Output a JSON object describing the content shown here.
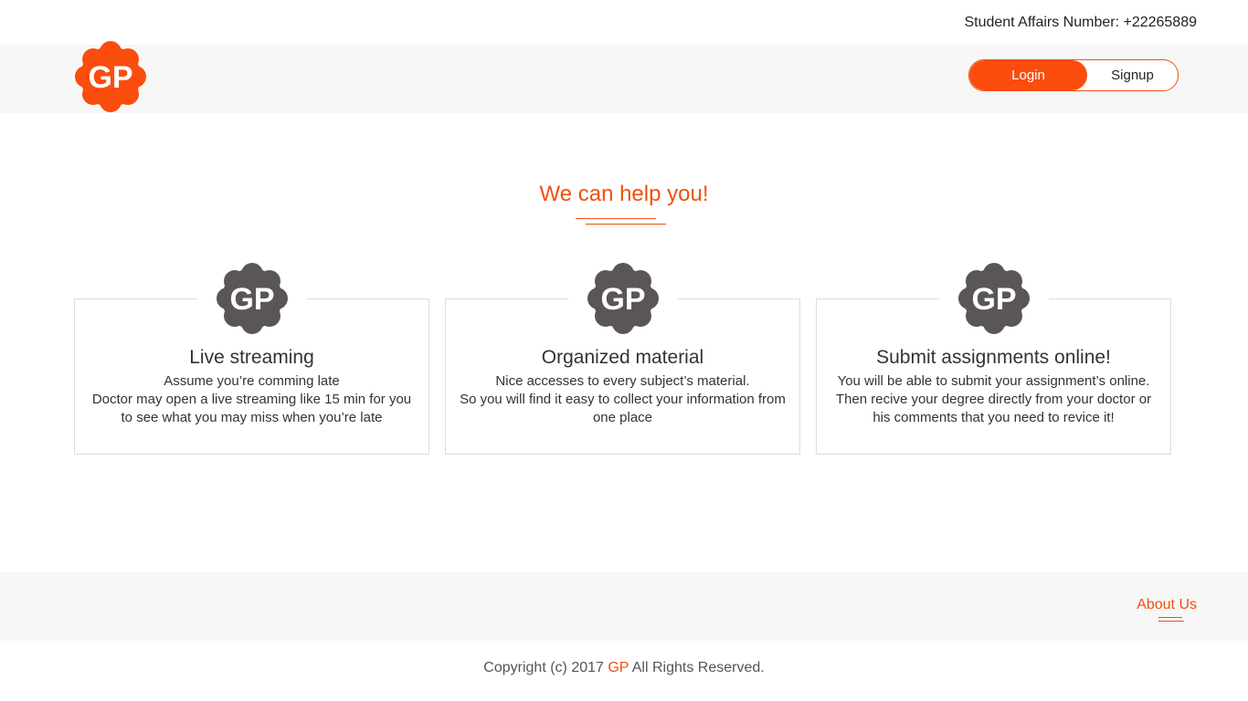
{
  "topbar": {
    "student_affairs": "Student Affairs Number: +22265889"
  },
  "header": {
    "logo_text": "GP",
    "login_label": "Login",
    "signup_label": "Signup"
  },
  "colors": {
    "accent": "#fa4d0e",
    "icon_gray": "#5a5655",
    "text": "#333333",
    "band": "#f7f7f7"
  },
  "section": {
    "title": "We can help you!"
  },
  "features": [
    {
      "icon": "GP",
      "title": "Live streaming",
      "line1": "Assume you’re comming late",
      "line2": "Doctor may open a live streaming like 15 min for you to see what you may miss when you’re late"
    },
    {
      "icon": "GP",
      "title": "Organized material",
      "line1": "Nice accesses to every subject’s material.",
      "line2": "So you will find it easy to collect your information from one place"
    },
    {
      "icon": "GP",
      "title": "Submit assignments online!",
      "line1": "You will be able to submit your assignment’s online.",
      "line2": "Then recive your degree directly from your doctor or his comments that you need to revice it!"
    }
  ],
  "footer": {
    "about_label": "About Us",
    "copyright_prefix": "Copyright (c) 2017 ",
    "brand": "GP",
    "copyright_suffix": " All Rights Reserved."
  }
}
